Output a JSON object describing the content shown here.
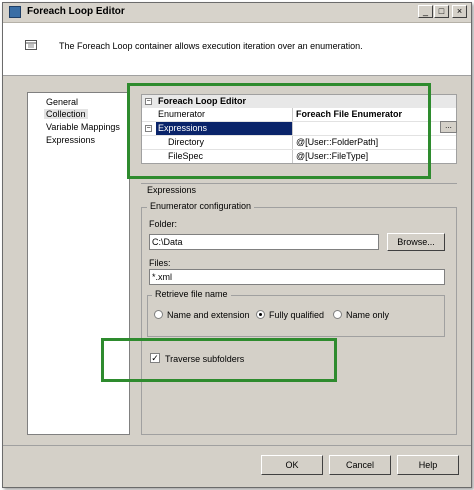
{
  "window": {
    "title": "Foreach Loop Editor",
    "buttons": {
      "minimize": "_",
      "maximize": "□",
      "close": "×"
    }
  },
  "header": {
    "icon": "container-icon",
    "description": "The Foreach Loop container allows execution iteration over an enumeration."
  },
  "nav": {
    "items": [
      {
        "label": "General"
      },
      {
        "label": "Collection",
        "selected": true
      },
      {
        "label": "Variable Mappings"
      },
      {
        "label": "Expressions"
      }
    ]
  },
  "property_grid": {
    "section_title": "Foreach Loop Editor",
    "rows": [
      {
        "label": "Enumerator",
        "value": "Foreach File Enumerator"
      },
      {
        "label": "Expressions",
        "value": "",
        "selected": true
      },
      {
        "label": "Directory",
        "value": "@[User::FolderPath]"
      },
      {
        "label": "FileSpec",
        "value": "@[User::FileType]"
      }
    ],
    "ellipsis_label": "...",
    "selection_color": "#0a246a"
  },
  "description_panel": {
    "title": "Expressions"
  },
  "enumerator_config": {
    "legend": "Enumerator configuration",
    "folder_label": "Folder:",
    "folder_value": "C:\\Data",
    "browse_label": "Browse...",
    "files_label": "Files:",
    "files_value": "*.xml",
    "retrieve_legend": "Retrieve file name",
    "options": [
      {
        "label": "Name and extension",
        "checked": false
      },
      {
        "label": "Fully qualified",
        "checked": true
      },
      {
        "label": "Name only",
        "checked": false
      }
    ],
    "traverse_label": "Traverse subfolders",
    "traverse_checked": true
  },
  "footer": {
    "ok_label": "OK",
    "cancel_label": "Cancel",
    "help_label": "Help"
  },
  "highlight_color": "#2e8b2e"
}
